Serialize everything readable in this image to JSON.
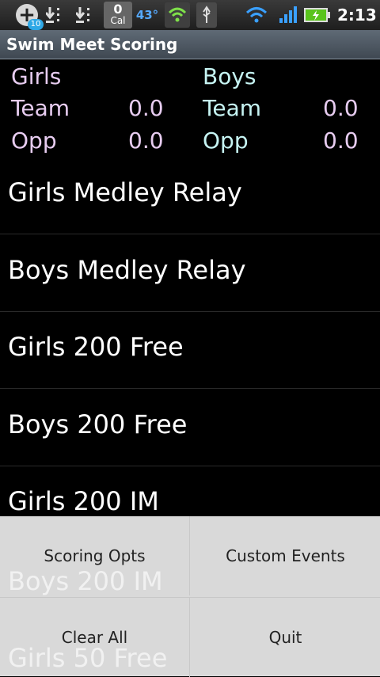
{
  "status": {
    "notification_count": "10",
    "cal_top": "0",
    "cal_label": "Cal",
    "temperature": "43°",
    "time": "2:13"
  },
  "app": {
    "title": "Swim Meet Scoring"
  },
  "scores": {
    "girls": {
      "header": "Girls",
      "team_label": "Team",
      "team_value": "0.0",
      "opp_label": "Opp",
      "opp_value": "0.0"
    },
    "boys": {
      "header": "Boys",
      "team_label": "Team",
      "team_value": "0.0",
      "opp_label": "Opp",
      "opp_value": "0.0"
    }
  },
  "events": [
    "Girls Medley Relay",
    "Boys Medley Relay",
    "Girls 200 Free",
    "Boys 200 Free",
    "Girls 200 IM",
    "Boys 200 IM",
    "Girls 50 Free"
  ],
  "menu": {
    "scoring_opts": "Scoring Opts",
    "custom_events": "Custom Events",
    "clear_all": "Clear All",
    "quit": "Quit"
  },
  "colors": {
    "girls_text": "#e7ccf0",
    "boys_text": "#c6f4f3",
    "background": "#000000"
  }
}
